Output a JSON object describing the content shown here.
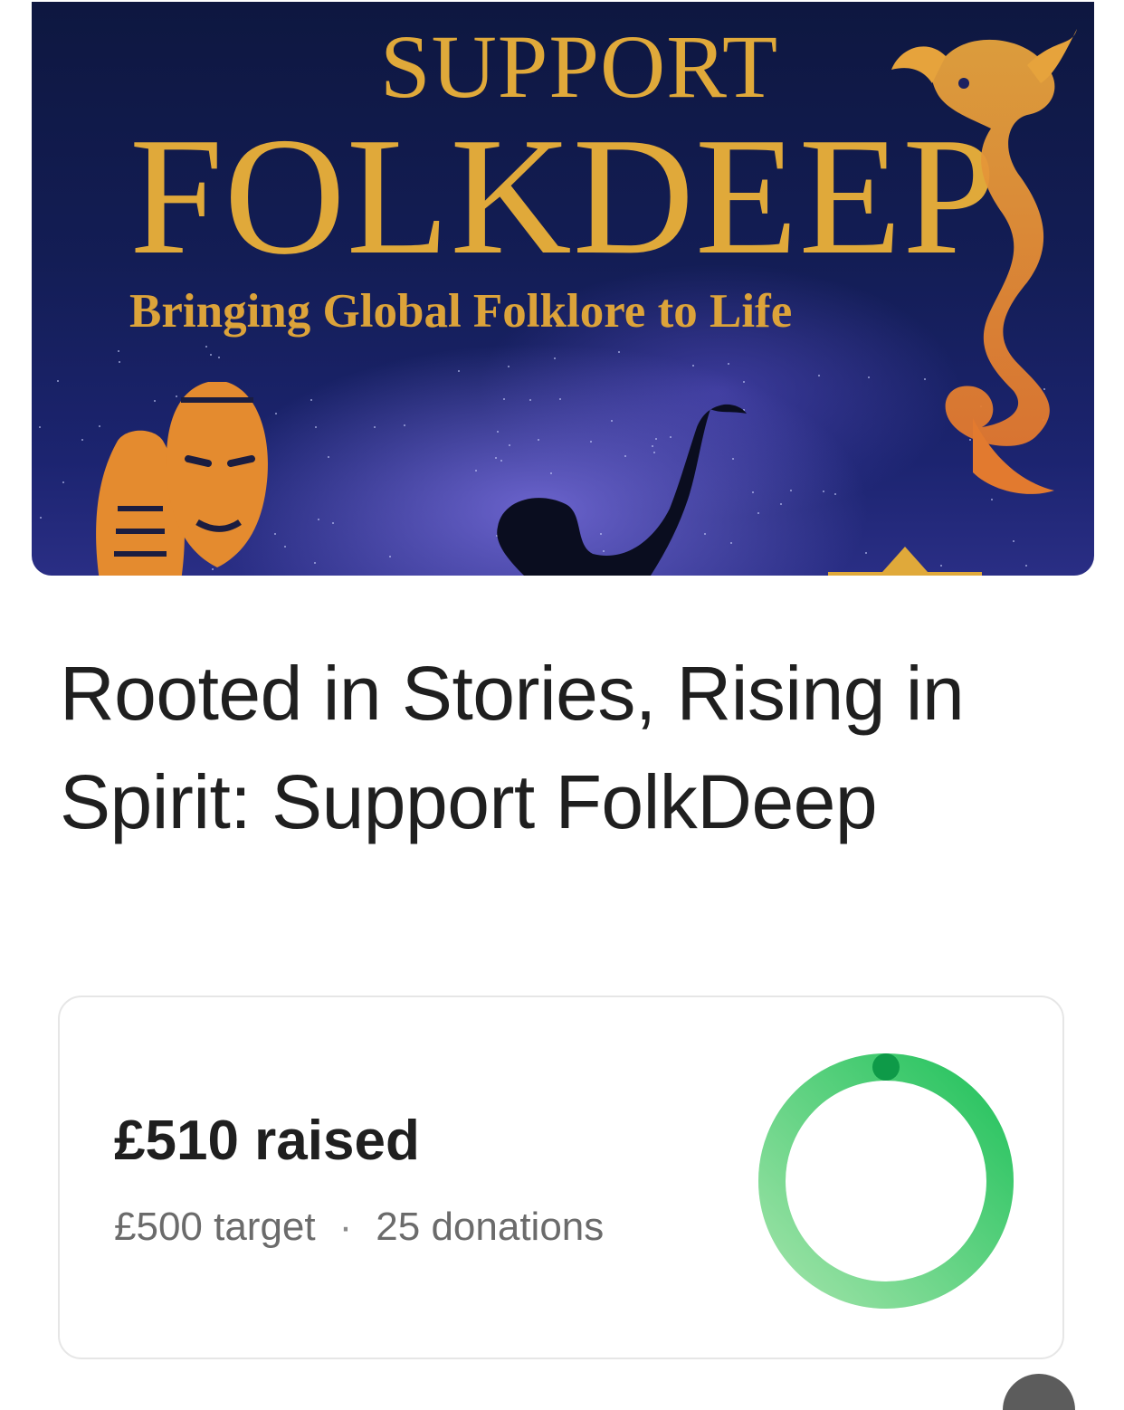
{
  "banner": {
    "title_top": "SUPPORT",
    "title_main": "FOLKDEEP",
    "subtitle": "Bringing Global Folklore to Life"
  },
  "campaign": {
    "title": "Rooted in Stories, Rising in Spirit: Support FolkDeep"
  },
  "donation_card": {
    "raised_label": "£510 raised",
    "target_label": "£500 target",
    "separator": "·",
    "donations_label": "25 donations",
    "progress_fraction": 1.02,
    "colors": {
      "ring_start": "#0e9a48",
      "ring_end": "#9fe3a8",
      "ring_mid": "#23c25d"
    }
  },
  "colors": {
    "banner_gold": "#e0a93a",
    "banner_bg": "#131d55",
    "text_primary": "#1f1f1f",
    "text_secondary": "#6b6b6b"
  }
}
